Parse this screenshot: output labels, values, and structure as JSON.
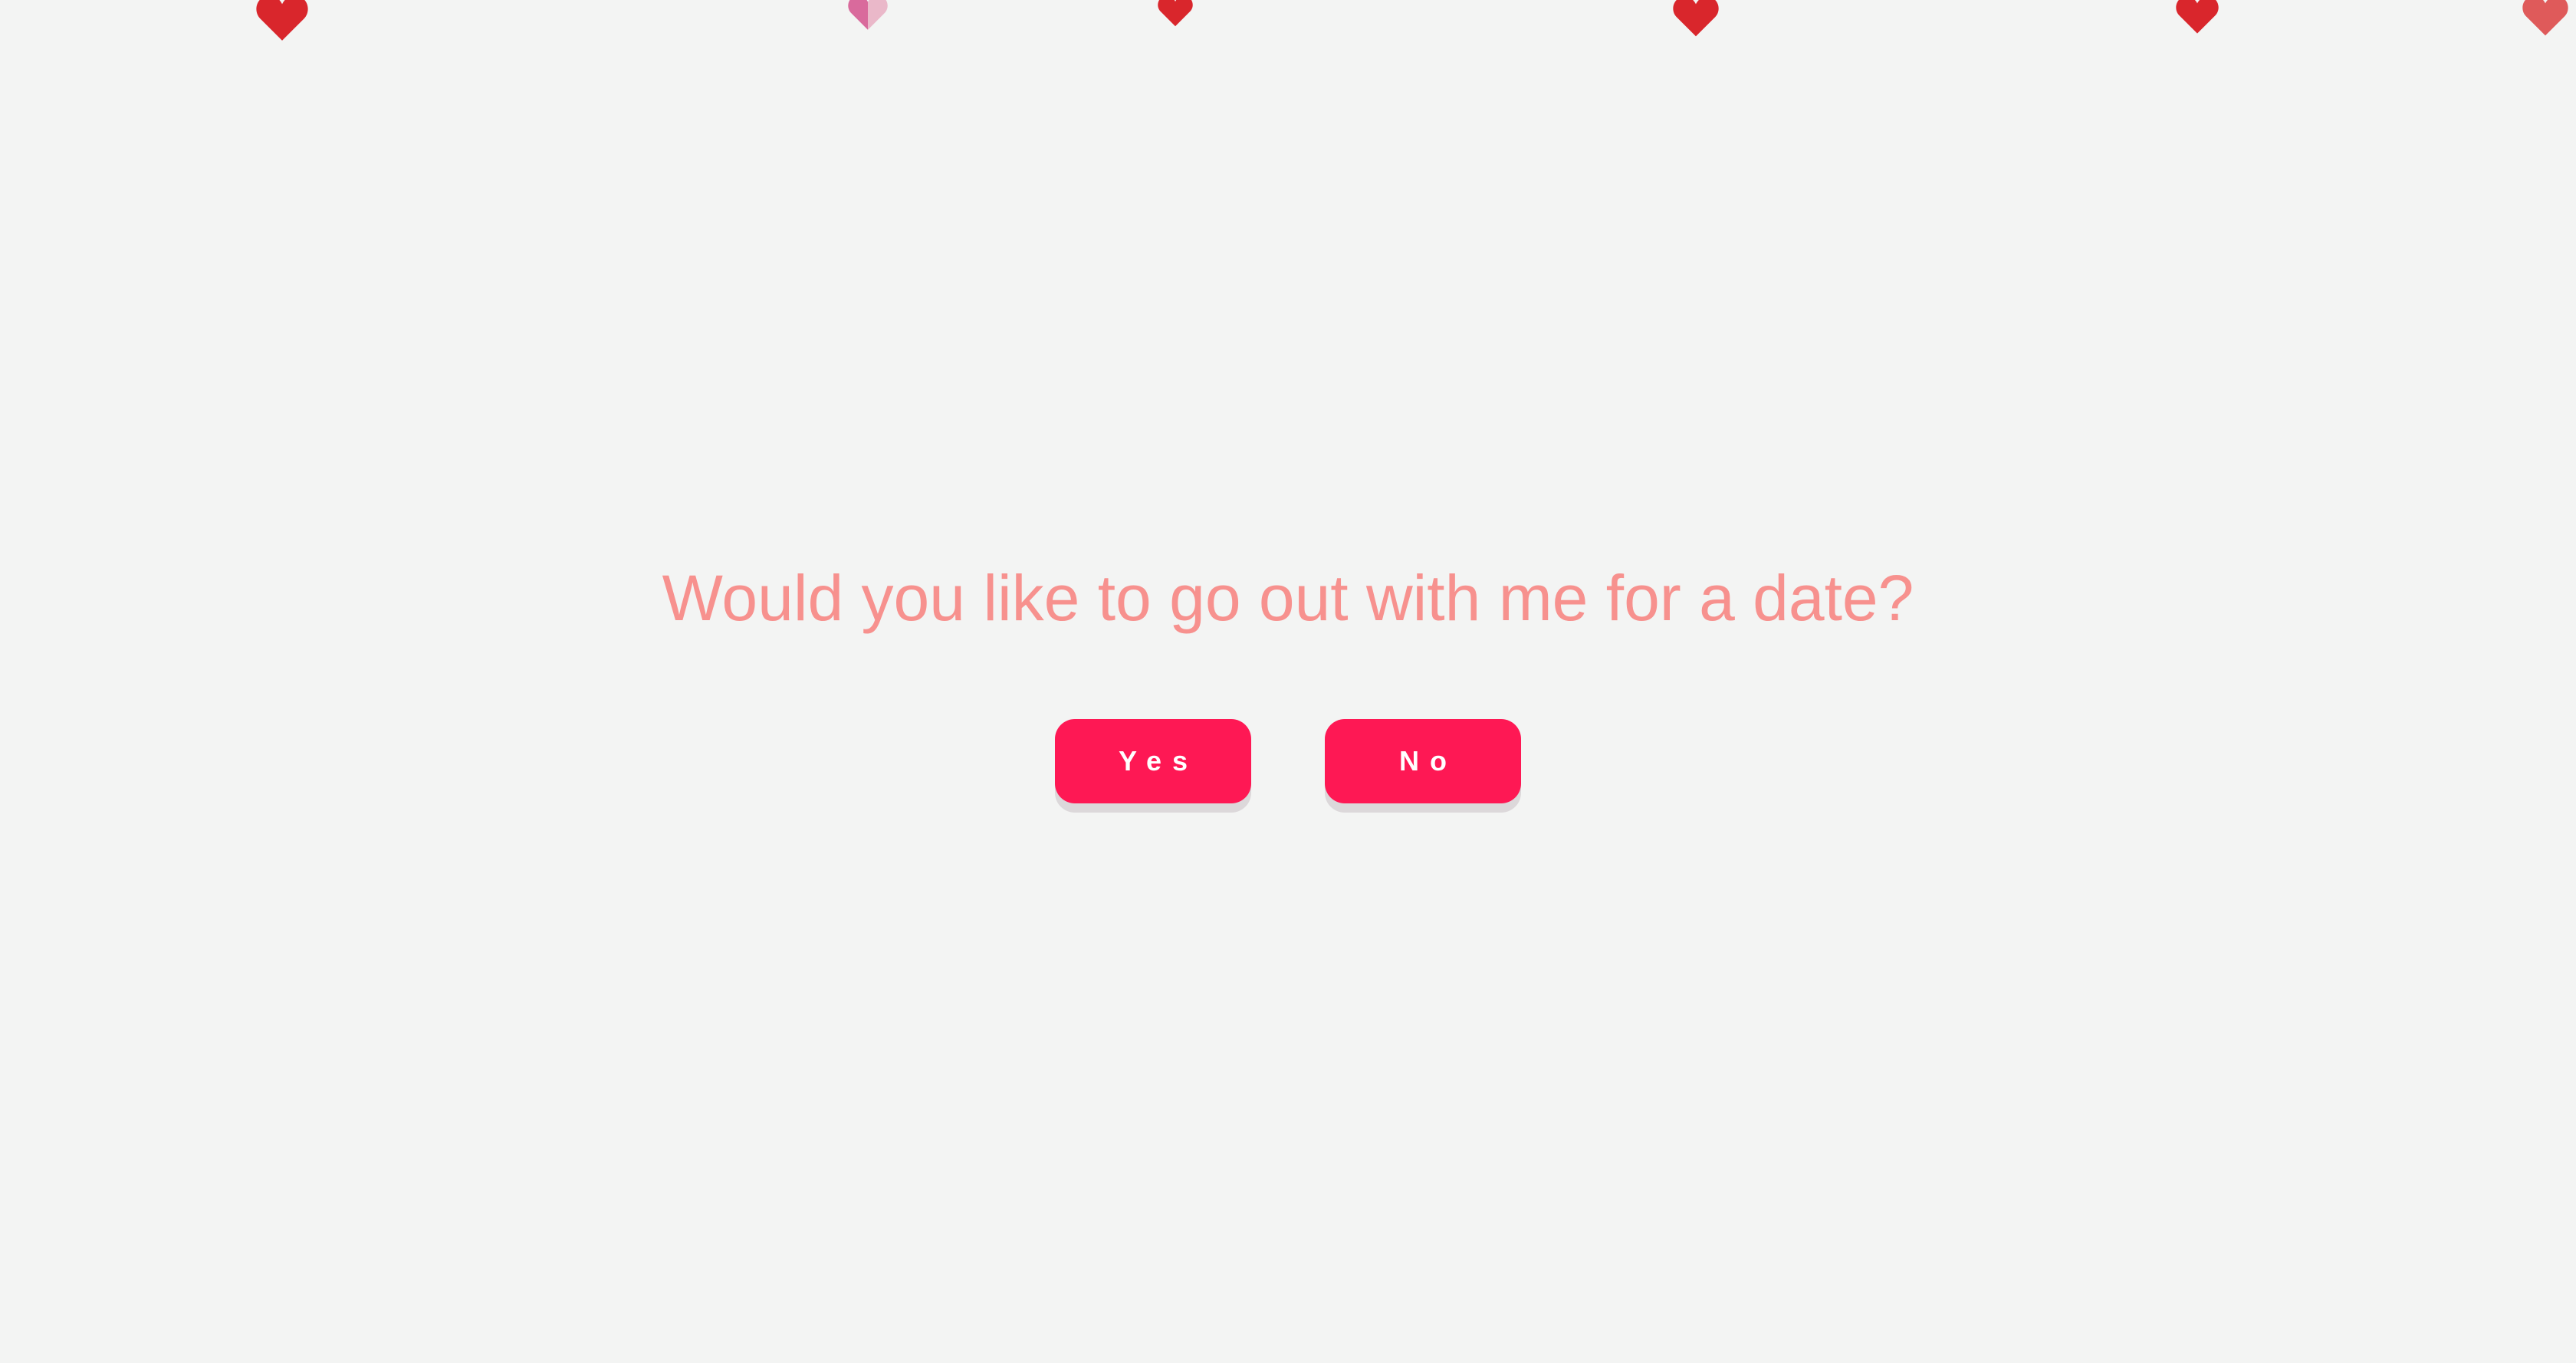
{
  "page": {
    "background": "#f3f4f3"
  },
  "question": {
    "text": "Would you like to go out with me for a date?",
    "color": "#f7918e"
  },
  "buttons": {
    "yes_label": "Yes",
    "no_label": "No",
    "color": "#fe1854",
    "text_color": "#ffffff"
  },
  "decorations": {
    "falling_hearts": [
      {
        "icon": "heart-icon",
        "color": "#d9262c"
      },
      {
        "icon": "heart-icon",
        "color": "#d96a9c",
        "style": "half-faded"
      },
      {
        "icon": "heart-icon",
        "color": "#d9262c"
      },
      {
        "icon": "heart-icon",
        "color": "#d9262c"
      },
      {
        "icon": "heart-icon",
        "color": "#d9262c"
      },
      {
        "icon": "heart-icon",
        "color": "#df5a5a"
      }
    ]
  }
}
